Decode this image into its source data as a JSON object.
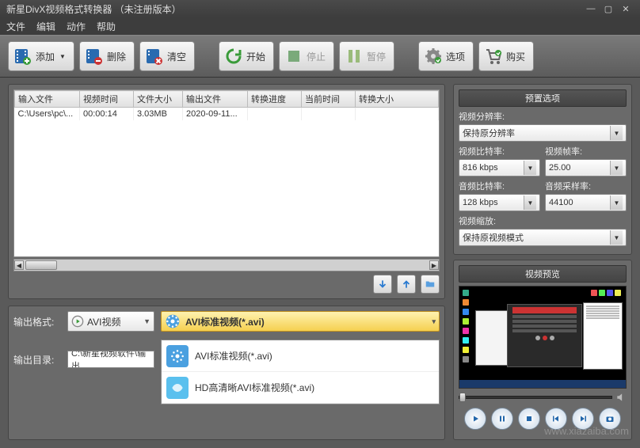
{
  "window": {
    "title": "新星DivX视频格式转换器 （未注册版本）"
  },
  "menu": {
    "file": "文件",
    "edit": "编辑",
    "action": "动作",
    "help": "帮助"
  },
  "toolbar": {
    "add": "添加",
    "delete": "删除",
    "clear": "清空",
    "start": "开始",
    "stop": "停止",
    "pause": "暂停",
    "options": "选项",
    "buy": "购买"
  },
  "table": {
    "headers": {
      "input": "输入文件",
      "vtime": "视频时间",
      "size": "文件大小",
      "output": "输出文件",
      "progress": "转换进度",
      "curtime": "当前时间",
      "convsize": "转换大小"
    },
    "rows": [
      {
        "input": "C:\\Users\\pc\\...",
        "vtime": "00:00:14",
        "size": "3.03MB",
        "output": "2020-09-11...",
        "progress": "",
        "curtime": "",
        "convsize": ""
      }
    ]
  },
  "output": {
    "format_label": "输出格式:",
    "format_value": "AVI视频",
    "selected_format": "AVI标准视频(*.avi)",
    "dir_label": "输出目录:",
    "dir_value": "C:\\新星视频软件\\输出",
    "list": [
      {
        "label": "AVI标准视频(*.avi)"
      },
      {
        "label": "HD高清晰AVI标准视频(*.avi)"
      }
    ]
  },
  "preset": {
    "title": "预置选项",
    "res_label": "视频分辨率:",
    "res_value": "保持原分辨率",
    "vbit_label": "视频比特率:",
    "vbit_value": "816 kbps",
    "vfps_label": "视频帧率:",
    "vfps_value": "25.00",
    "abit_label": "音频比特率:",
    "abit_value": "128 kbps",
    "asr_label": "音频采样率:",
    "asr_value": "44100",
    "scale_label": "视频缩放:",
    "scale_value": "保持原视频模式"
  },
  "preview": {
    "title": "视频预览"
  },
  "watermark": "www.xiazaiba.com"
}
